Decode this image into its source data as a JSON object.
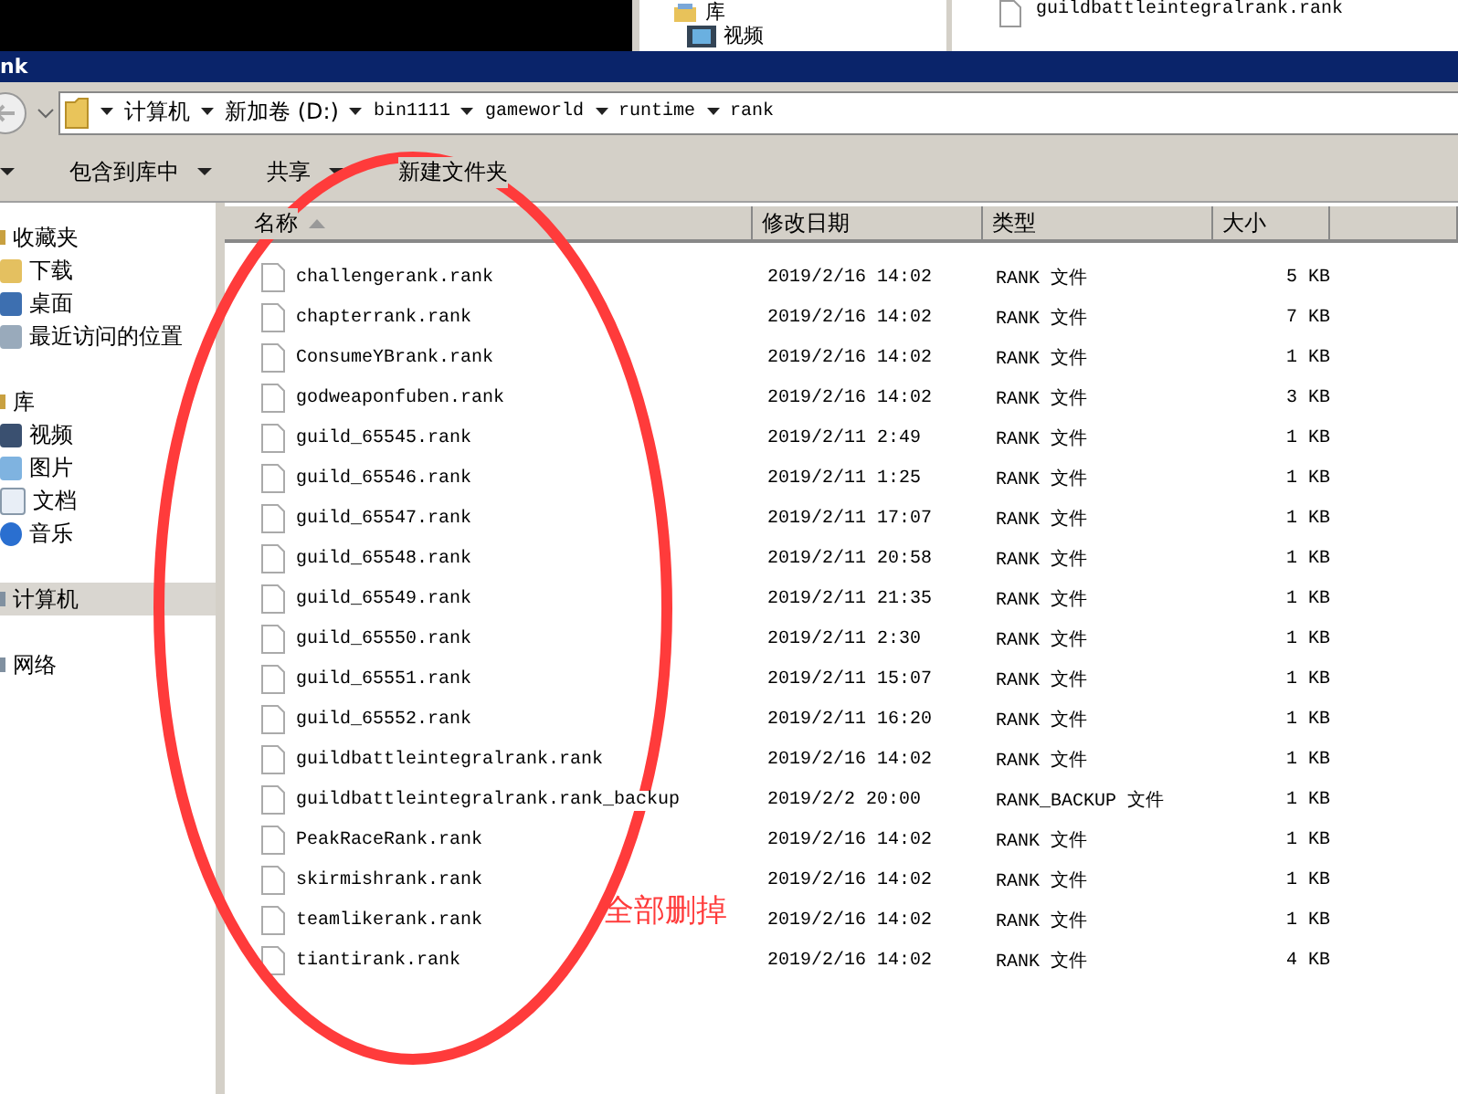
{
  "background_window": {
    "nav": [
      {
        "label": "库",
        "kind": "library"
      },
      {
        "label": "视频",
        "kind": "video"
      }
    ],
    "file": "guildbattleintegralrank.rank"
  },
  "window": {
    "title": "nk"
  },
  "address": {
    "crumbs": [
      "计算机",
      "新加卷 (D:)",
      "bin1111",
      "gameworld",
      "runtime",
      "rank"
    ]
  },
  "toolbar": [
    {
      "menu": true
    },
    {
      "label": "包含到库中",
      "menu": true
    },
    {
      "label": "共享",
      "menu": true
    },
    {
      "label": "新建文件夹",
      "menu": false
    }
  ],
  "sidebar": {
    "groups": [
      {
        "label": "收藏夹",
        "kind": "favorites",
        "selected": false,
        "children": [
          {
            "label": "下载",
            "kind": "download"
          },
          {
            "label": "桌面",
            "kind": "desktop"
          },
          {
            "label": "最近访问的位置",
            "kind": "recent"
          }
        ]
      },
      {
        "label": "库",
        "kind": "library",
        "selected": false,
        "children": [
          {
            "label": "视频",
            "kind": "video"
          },
          {
            "label": "图片",
            "kind": "picture"
          },
          {
            "label": "文档",
            "kind": "document"
          },
          {
            "label": "音乐",
            "kind": "music"
          }
        ]
      },
      {
        "label": "计算机",
        "kind": "computer",
        "selected": true
      },
      {
        "label": "网络",
        "kind": "network",
        "selected": false
      }
    ]
  },
  "table": {
    "columns": [
      "名称",
      "修改日期",
      "类型",
      "大小"
    ],
    "rows": [
      {
        "name": "challengerank.rank",
        "date": "2019/2/16 14:02",
        "type": "RANK 文件",
        "size": "5 KB"
      },
      {
        "name": "chapterrank.rank",
        "date": "2019/2/16 14:02",
        "type": "RANK 文件",
        "size": "7 KB"
      },
      {
        "name": "ConsumeYBrank.rank",
        "date": "2019/2/16 14:02",
        "type": "RANK 文件",
        "size": "1 KB"
      },
      {
        "name": "godweaponfuben.rank",
        "date": "2019/2/16 14:02",
        "type": "RANK 文件",
        "size": "3 KB"
      },
      {
        "name": "guild_65545.rank",
        "date": "2019/2/11 2:49",
        "type": "RANK 文件",
        "size": "1 KB"
      },
      {
        "name": "guild_65546.rank",
        "date": "2019/2/11 1:25",
        "type": "RANK 文件",
        "size": "1 KB"
      },
      {
        "name": "guild_65547.rank",
        "date": "2019/2/11 17:07",
        "type": "RANK 文件",
        "size": "1 KB"
      },
      {
        "name": "guild_65548.rank",
        "date": "2019/2/11 20:58",
        "type": "RANK 文件",
        "size": "1 KB"
      },
      {
        "name": "guild_65549.rank",
        "date": "2019/2/11 21:35",
        "type": "RANK 文件",
        "size": "1 KB"
      },
      {
        "name": "guild_65550.rank",
        "date": "2019/2/11 2:30",
        "type": "RANK 文件",
        "size": "1 KB"
      },
      {
        "name": "guild_65551.rank",
        "date": "2019/2/11 15:07",
        "type": "RANK 文件",
        "size": "1 KB"
      },
      {
        "name": "guild_65552.rank",
        "date": "2019/2/11 16:20",
        "type": "RANK 文件",
        "size": "1 KB"
      },
      {
        "name": "guildbattleintegralrank.rank",
        "date": "2019/2/16 14:02",
        "type": "RANK 文件",
        "size": "1 KB"
      },
      {
        "name": "guildbattleintegralrank.rank_backup",
        "date": "2019/2/2 20:00",
        "type": "RANK_BACKUP 文件",
        "size": "1 KB"
      },
      {
        "name": "PeakRaceRank.rank",
        "date": "2019/2/16 14:02",
        "type": "RANK 文件",
        "size": "1 KB"
      },
      {
        "name": "skirmishrank.rank",
        "date": "2019/2/16 14:02",
        "type": "RANK 文件",
        "size": "1 KB"
      },
      {
        "name": "teamlikerank.rank",
        "date": "2019/2/16 14:02",
        "type": "RANK 文件",
        "size": "1 KB"
      },
      {
        "name": "tiantirank.rank",
        "date": "2019/2/16 14:02",
        "type": "RANK 文件",
        "size": "4 KB"
      }
    ]
  },
  "annotation": {
    "text": "全部删掉",
    "color": "#ff3b3b"
  }
}
